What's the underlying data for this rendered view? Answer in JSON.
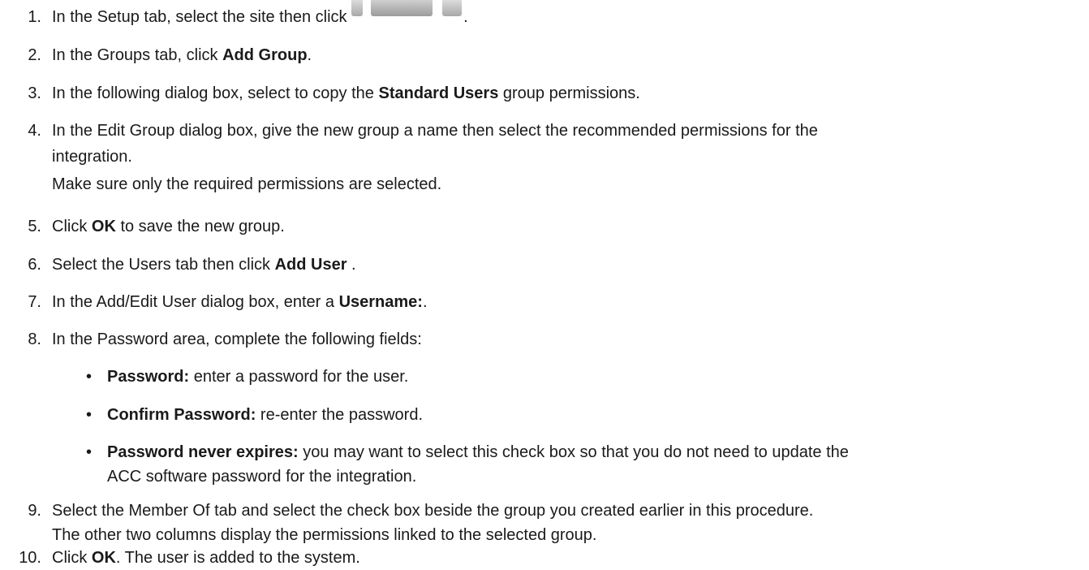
{
  "steps": [
    {
      "num": "1.",
      "pre": "In the Setup tab, select the site then click",
      "post": "."
    },
    {
      "num": "2.",
      "pre": "In the Groups tab, click ",
      "bold": "Add Group",
      "post": "."
    },
    {
      "num": "3.",
      "pre": "In the following dialog box, select to copy the ",
      "bold": "Standard Users",
      "post": " group permissions."
    },
    {
      "num": "4.",
      "line1": "In the Edit Group dialog box, give the new group a name then select the recommended permissions for the",
      "line2": "integration.",
      "line3": "Make sure only the required permissions are selected."
    },
    {
      "num": "5.",
      "pre": "Click ",
      "bold": "OK",
      "post": " to save the new group."
    },
    {
      "num": "6.",
      "pre": "Select the Users tab then click ",
      "bold": "Add User",
      "post": " ."
    },
    {
      "num": "7.",
      "pre": "In the Add/Edit User dialog box, enter a ",
      "bold": "Username:",
      "post": "."
    },
    {
      "num": "8.",
      "text": "In the Password area, complete the following fields:"
    },
    {
      "num": "9.",
      "line1": "Select the Member Of tab and select the check box beside the group you created earlier in this procedure.",
      "line2": "The other two columns display the permissions linked to the selected group."
    },
    {
      "num": "10.",
      "pre": "Click ",
      "bold": "OK",
      "post": ". The user is added to the system."
    }
  ],
  "bullets": [
    {
      "bold": "Password:",
      "text": " enter a password for the user."
    },
    {
      "bold": "Confirm Password:",
      "text": " re-enter the password."
    },
    {
      "bold": "Password never expires:",
      "text": " you may want to select this check box so that you do not need to update the",
      "text2": "ACC software password for the integration."
    }
  ],
  "bullet_char": "•",
  "setup_icon": "setup-icon"
}
